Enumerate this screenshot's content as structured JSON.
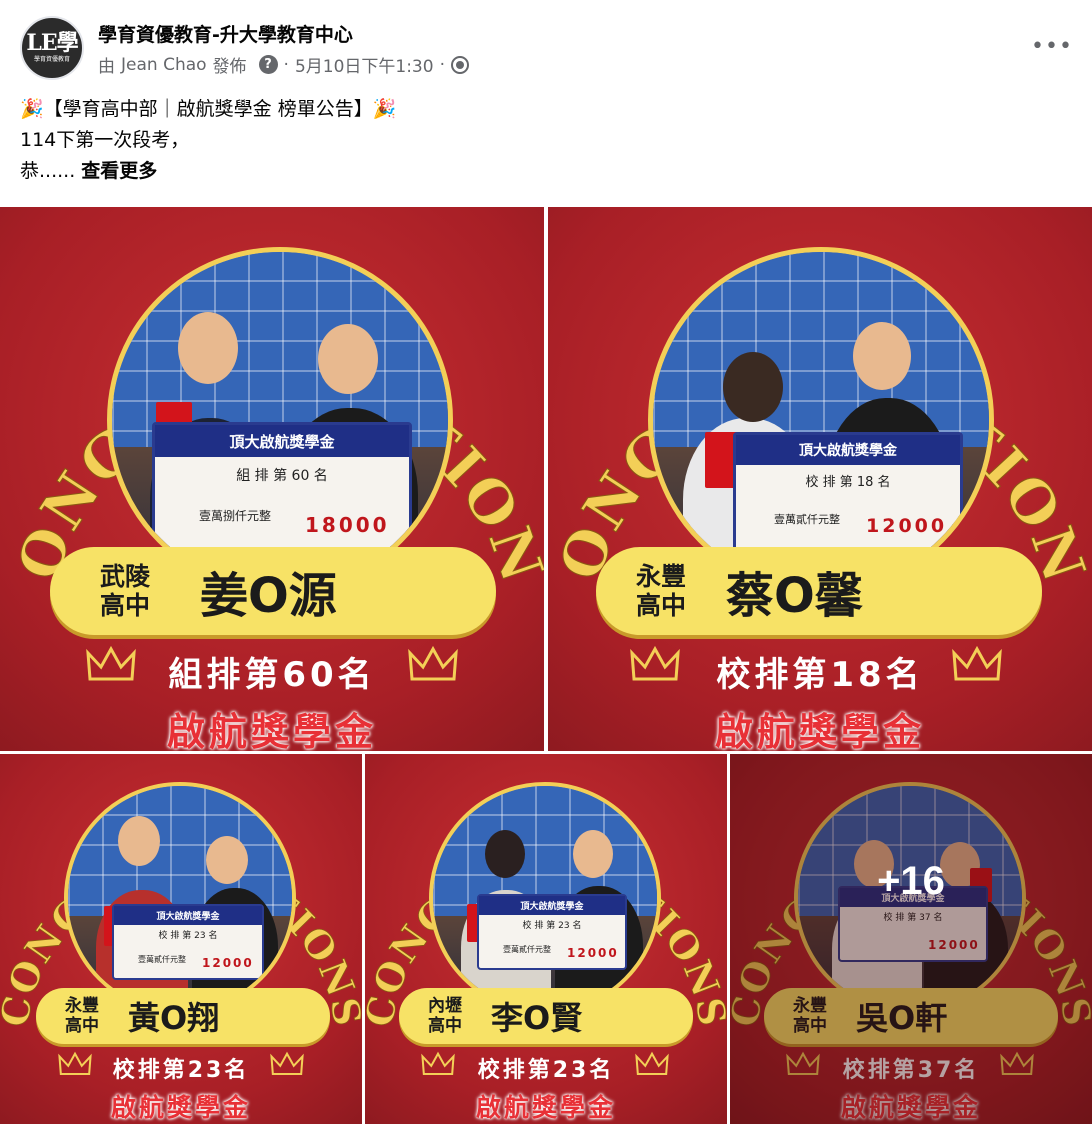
{
  "post": {
    "page_name": "學育資優教育-升大學教育中心",
    "avatar_text": "LE學",
    "avatar_subtext": "學育資優教育",
    "author_prefix": "由",
    "author_name": "Jean Chao",
    "author_suffix": "發佈",
    "help_icon_text": "?",
    "timestamp": "5月10日下午1:30",
    "separator": "·",
    "more_label": "•••",
    "text_line1": "🎉【學育高中部｜啟航獎學金 榜單公告】🎉",
    "text_line2": "114下第一次段考，",
    "text_line3_start": "恭......",
    "see_more": "查看更多",
    "overflow_count": "+16"
  },
  "tiles": [
    {
      "school_line1": "武陵",
      "school_line2": "高中",
      "name": "姜O源",
      "rank": "組排第60名",
      "award": "啟航獎學金",
      "sign_title": "頂大啟航獎學金",
      "sign_rank": "組 排 第 60 名",
      "sign_words": "壹萬捌仟元整",
      "sign_amount": "18000"
    },
    {
      "school_line1": "永豐",
      "school_line2": "高中",
      "name": "蔡O馨",
      "rank": "校排第18名",
      "award": "啟航獎學金",
      "sign_title": "頂大啟航獎學金",
      "sign_rank": "校 排 第 18 名",
      "sign_words": "壹萬貳仟元整",
      "sign_amount": "12000"
    },
    {
      "school_line1": "永豐",
      "school_line2": "高中",
      "name": "黃O翔",
      "rank": "校排第23名",
      "award": "啟航獎學金",
      "sign_title": "頂大啟航獎學金",
      "sign_rank": "校 排 第 23 名",
      "sign_words": "壹萬貳仟元整",
      "sign_amount": "12000"
    },
    {
      "school_line1": "內壢",
      "school_line2": "高中",
      "name": "李O賢",
      "rank": "校排第23名",
      "award": "啟航獎學金",
      "sign_title": "頂大啟航獎學金",
      "sign_rank": "校 排 第 23 名",
      "sign_words": "壹萬貳仟元整",
      "sign_amount": "12000"
    },
    {
      "school_line1": "永豐",
      "school_line2": "高中",
      "name": "吳O軒",
      "rank": "校排第37名",
      "award": "啟航獎學金",
      "sign_title": "頂大啟航獎學金",
      "sign_rank": "校 排 第 37 名",
      "sign_words": "",
      "sign_amount": "12000"
    }
  ],
  "congrats_text": "CONGRATULATIONS",
  "colors": {
    "tile_red": "#b8242a",
    "gold": "#f3cf57",
    "banner_yellow": "#f7e266",
    "award_red": "#e83036",
    "meta_gray": "#65676b"
  }
}
